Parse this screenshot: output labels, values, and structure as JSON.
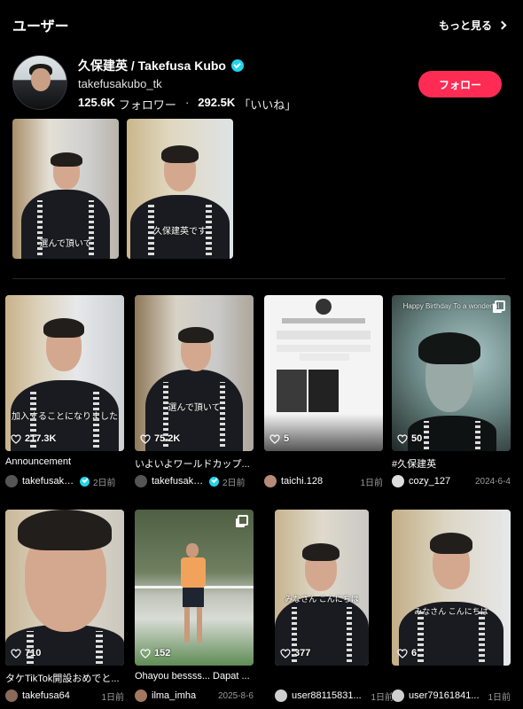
{
  "header": {
    "title": "ユーザー",
    "more_label": "もっと見る"
  },
  "profile": {
    "name": "久保建英 / Takefusa Kubo",
    "handle": "takefusakubo_tk",
    "followers": "125.6K",
    "followers_label": "フォロワー",
    "separator": "·",
    "likes": "292.5K",
    "likes_label": "「いいね」",
    "follow_label": "フォロー"
  },
  "profile_videos": [
    {
      "caption": "選んで頂いて"
    },
    {
      "caption": "久保建英です"
    }
  ],
  "videos": [
    {
      "title": "Announcement",
      "likes": "217.3K",
      "caption": "加入することになりました",
      "user": "takefusaku...",
      "verified": true,
      "date": "2日前"
    },
    {
      "title": "いよいよワールドカップ...",
      "likes": "75.2K",
      "caption": "選んで頂いて",
      "user": "takefusaku...",
      "verified": true,
      "date": "2日前"
    },
    {
      "title": "",
      "likes": "5",
      "caption": "",
      "user": "taichi.128",
      "verified": false,
      "date": "1日前"
    },
    {
      "title": "#久保建英",
      "likes": "50",
      "caption": "Happy Birthday To a wonderful",
      "user": "cozy_127",
      "verified": false,
      "date": "2024-6-4"
    },
    {
      "title": "タケTikTok開設おめでと...",
      "likes": "710",
      "caption": "",
      "user": "takefusa64",
      "verified": false,
      "date": "1日前"
    },
    {
      "title": "Ohayou bessss... Dapat ...",
      "likes": "152",
      "caption": "",
      "user": "ilma_imha",
      "verified": false,
      "date": "2025-8-6"
    },
    {
      "title": "",
      "likes": "377",
      "caption": "みなさん こんにちは",
      "user": "user88115831...",
      "verified": false,
      "date": "1日前"
    },
    {
      "title": "",
      "likes": "6",
      "caption": "みなさん こんにちは",
      "user": "user79161841...",
      "verified": false,
      "date": "1日前"
    }
  ],
  "colors": {
    "accent": "#fe2c55",
    "verified": "#20d5ec",
    "background": "#000000"
  },
  "icons": {
    "more": "chevron-right-icon",
    "verified": "verified-badge-icon",
    "likes": "heart-outline-icon",
    "gallery": "photo-gallery-icon"
  }
}
